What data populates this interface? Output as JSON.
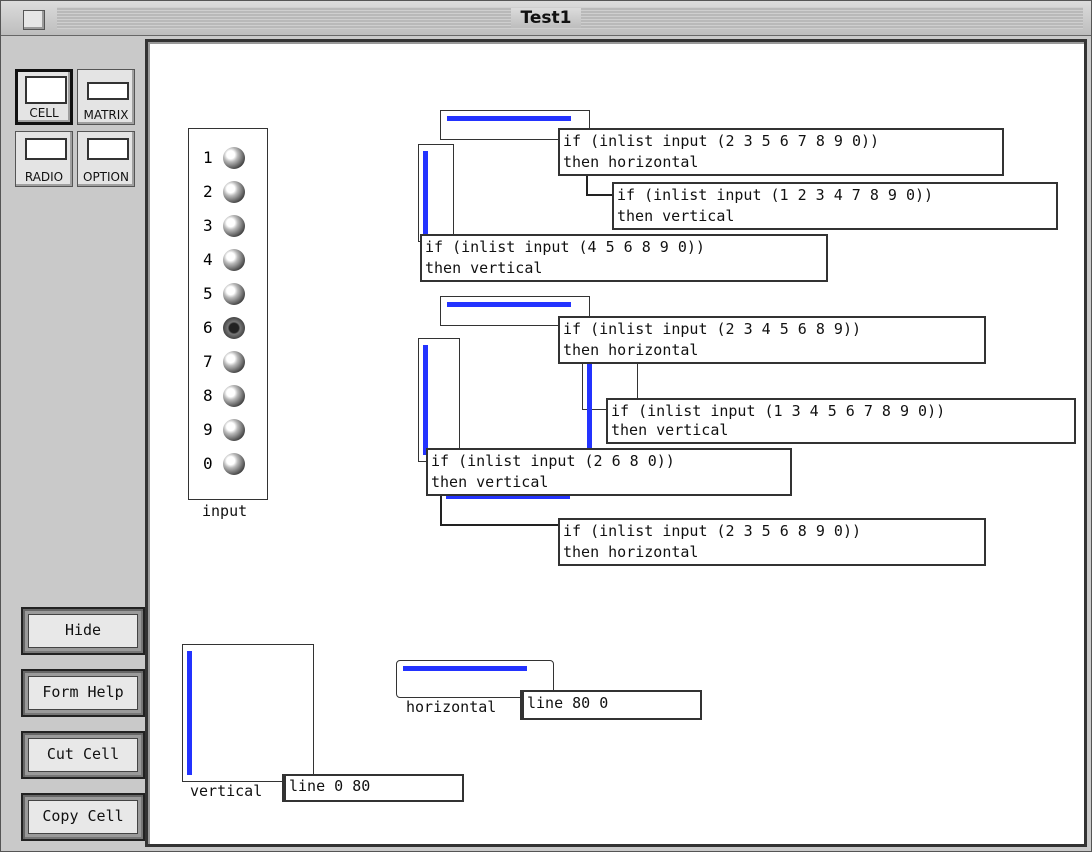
{
  "window": {
    "title": "Test1"
  },
  "palette": {
    "tools": [
      {
        "label": "CELL",
        "icon": "cell-icon",
        "selected": true
      },
      {
        "label": "MATRIX",
        "icon": "matrix-icon",
        "selected": false
      },
      {
        "label": "RADIO",
        "icon": "radio-icon",
        "selected": false
      },
      {
        "label": "OPTION",
        "icon": "option-icon",
        "selected": false
      }
    ],
    "buttons": [
      "Hide",
      "Form Help",
      "Cut Cell",
      "Copy Cell"
    ]
  },
  "input": {
    "label": "input",
    "options": [
      "1",
      "2",
      "3",
      "4",
      "5",
      "6",
      "7",
      "8",
      "9",
      "0"
    ],
    "selected": "6"
  },
  "rules": [
    {
      "line1": "if (inlist input (2 3 5 6 7 8 9 0))",
      "line2": "then horizontal"
    },
    {
      "line1": "if (inlist input (1 2 3 4 7 8 9 0))",
      "line2": "then vertical"
    },
    {
      "line1": "if (inlist input (4 5 6 8 9 0))",
      "line2": "then vertical"
    },
    {
      "line1": "if (inlist input (2 3 4 5 6 8 9))",
      "line2": "then horizontal"
    },
    {
      "line1": "if (inlist input (1 3 4 5 6 7 8 9 0))",
      "line2": "then vertical"
    },
    {
      "line1": "if (inlist input (2 6 8 0))",
      "line2": "then vertical"
    },
    {
      "line1": "if (inlist input (2 3 5 6 8 9 0))",
      "line2": "then horizontal"
    }
  ],
  "horizontal": {
    "label": "horizontal",
    "formula": "line 80 0"
  },
  "vertical": {
    "label": "vertical",
    "formula": "line 0 80"
  },
  "colors": {
    "segment": "#2333ff"
  }
}
